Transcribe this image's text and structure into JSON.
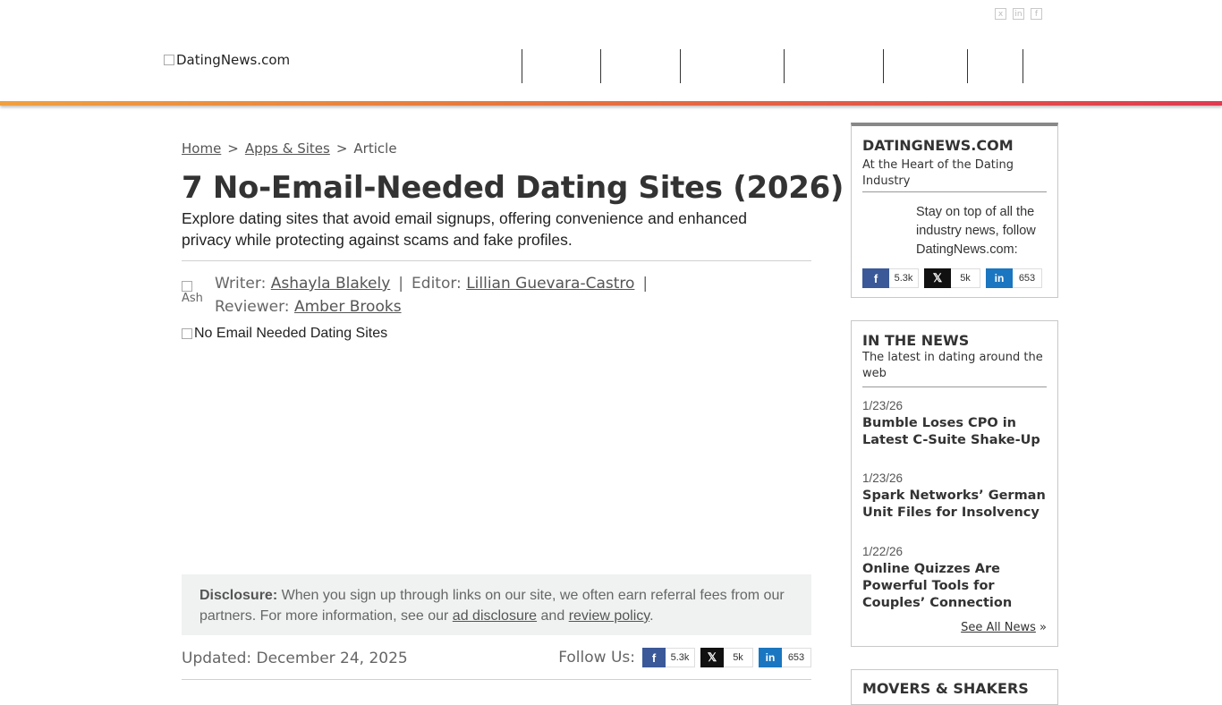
{
  "header": {
    "logo_alt": "DatingNews.com",
    "top_social": [
      "x",
      "in",
      "f"
    ]
  },
  "breadcrumb": {
    "home": "Home",
    "sep": ">",
    "category": "Apps & Sites",
    "current": "Article"
  },
  "article": {
    "title": "7 No-Email-Needed Dating Sites (2026)",
    "subtitle": "Explore dating sites that avoid email signups, offering convenience and enhanced privacy while protecting against scams and fake profiles.",
    "avatar_alt": "Ash",
    "writer_label": "Writer:",
    "writer": "Ashayla Blakely",
    "editor_label": "Editor:",
    "editor": "Lillian Guevara-Castro",
    "reviewer_label": "Reviewer:",
    "reviewer": "Amber Brooks",
    "pipe": "|",
    "hero_alt": "No Email Needed Dating Sites",
    "disclosure_label": "Disclosure:",
    "disclosure_text": "When you sign up through links on our site, we often earn referral fees from our partners. For more information, see our",
    "ad_disclosure": "ad disclosure",
    "and": "and",
    "review_policy": "review policy",
    "period": ".",
    "updated": "Updated: December 24, 2025",
    "follow_us": "Follow Us:"
  },
  "social_counts": {
    "facebook": "5.3k",
    "x": "5k",
    "linkedin": "653"
  },
  "sidebar": {
    "box1": {
      "title": "DATINGNEWS.COM",
      "subtitle": "At the Heart of the Dating Industry",
      "stay_text": "Stay on top of all the industry news, follow DatingNews.com:"
    },
    "box2": {
      "title": "IN THE NEWS",
      "subtitle": "The latest in dating around the web",
      "items": [
        {
          "date": "1/23/26",
          "headline": "Bumble Loses CPO in Latest C-Suite Shake-Up"
        },
        {
          "date": "1/23/26",
          "headline": "Spark Networks’ German Unit Files for Insolvency"
        },
        {
          "date": "1/22/26",
          "headline": "Online Quizzes Are Powerful Tools for Couples’ Connection"
        }
      ],
      "see_all": "See All News",
      "see_all_arrow": "»"
    },
    "box3": {
      "title": "MOVERS & SHAKERS"
    }
  },
  "colors": {
    "facebook": "#3b5998",
    "x": "#111111",
    "linkedin": "#1a76c0",
    "accent_start": "#f0a040",
    "accent_end": "#e03a50"
  }
}
